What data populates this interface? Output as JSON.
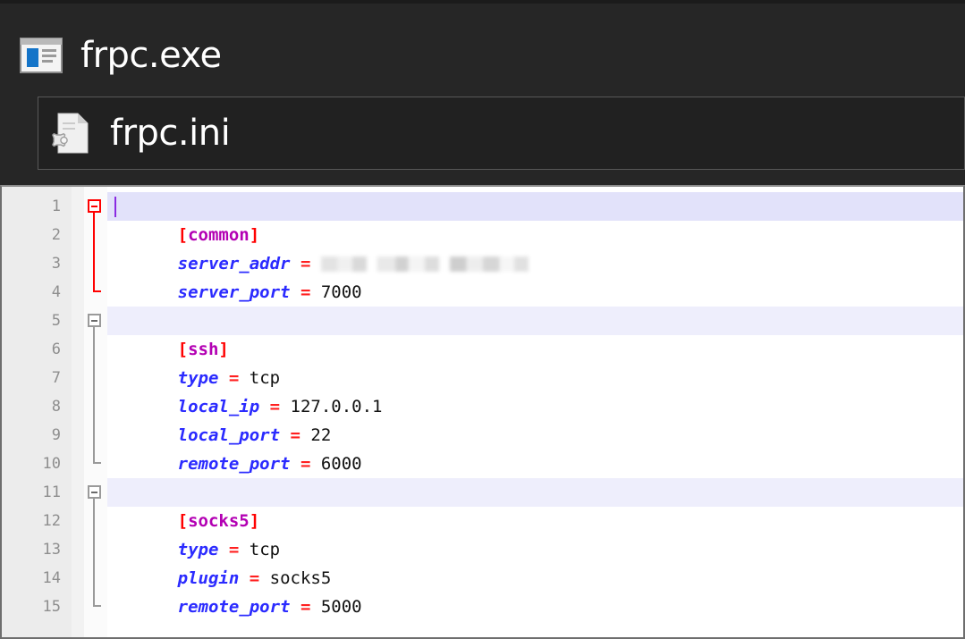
{
  "explorer": {
    "files": [
      {
        "name": "frpc.exe",
        "icon": "application-window-icon",
        "selected": false
      },
      {
        "name": "frpc.ini",
        "icon": "ini-config-file-icon",
        "selected": true
      }
    ]
  },
  "editor": {
    "line_numbers": [
      "1",
      "2",
      "3",
      "4",
      "5",
      "6",
      "7",
      "8",
      "9",
      "10",
      "11",
      "12",
      "13",
      "14",
      "15"
    ],
    "lines": [
      {
        "n": "1",
        "type": "section",
        "open": "[",
        "name": "common",
        "close": "]",
        "highlight": "active",
        "fold": "red",
        "caret": true
      },
      {
        "n": "2",
        "type": "pair",
        "key": "server_addr",
        "eq": "=",
        "value": "",
        "redacted": true
      },
      {
        "n": "3",
        "type": "pair",
        "key": "server_port",
        "eq": "=",
        "value": "7000"
      },
      {
        "n": "4",
        "type": "blank"
      },
      {
        "n": "5",
        "type": "section",
        "open": "[",
        "name": "ssh",
        "close": "]",
        "highlight": "plain",
        "fold": "gray"
      },
      {
        "n": "6",
        "type": "pair",
        "key": "type",
        "eq": "=",
        "value": "tcp"
      },
      {
        "n": "7",
        "type": "pair",
        "key": "local_ip",
        "eq": "=",
        "value": "127.0.0.1"
      },
      {
        "n": "8",
        "type": "pair",
        "key": "local_port",
        "eq": "=",
        "value": "22"
      },
      {
        "n": "9",
        "type": "pair",
        "key": "remote_port",
        "eq": "=",
        "value": "6000"
      },
      {
        "n": "10",
        "type": "blank"
      },
      {
        "n": "11",
        "type": "section",
        "open": "[",
        "name": "socks5",
        "close": "]",
        "highlight": "plain",
        "fold": "gray"
      },
      {
        "n": "12",
        "type": "pair",
        "key": "type",
        "eq": "=",
        "value": "tcp"
      },
      {
        "n": "13",
        "type": "pair",
        "key": "plugin",
        "eq": "=",
        "value": "socks5"
      },
      {
        "n": "14",
        "type": "pair",
        "key": "remote_port",
        "eq": "=",
        "value": "5000"
      },
      {
        "n": "15",
        "type": "blank"
      }
    ],
    "colors": {
      "bracket": "#ff0000",
      "section_name": "#b300b3",
      "key": "#2b2bff",
      "equals": "#ff2020",
      "value": "#111111",
      "gutter_bg": "#ececec",
      "line_number": "#8e8e8e",
      "section_highlight": "#eeeefc",
      "section_highlight_active": "#e2e2fa",
      "fold_marker_active": "#ff0000",
      "fold_marker": "#9a9a9a",
      "caret": "#8a2be2",
      "editor_bg": "#ffffff",
      "explorer_bg": "#262626",
      "explorer_text": "#ffffff",
      "selection_border": "#585858"
    }
  }
}
